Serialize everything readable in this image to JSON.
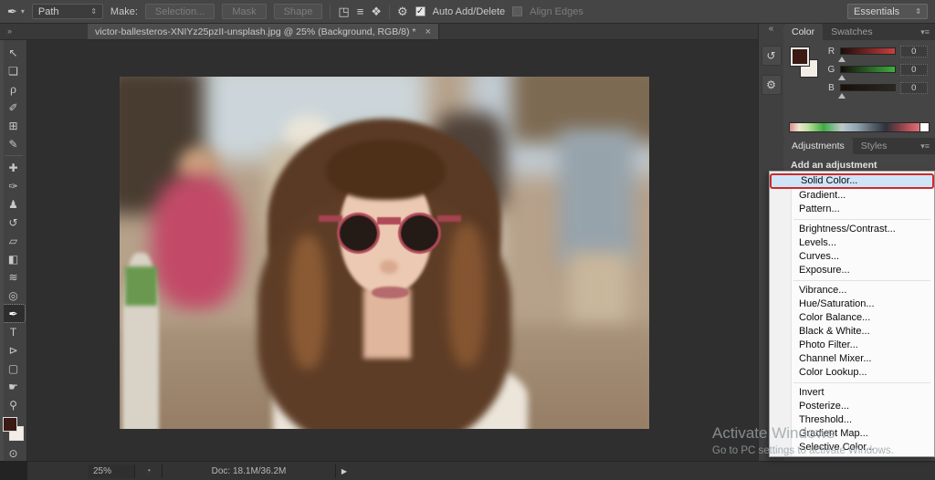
{
  "options_bar": {
    "tool_icon": "pen-icon",
    "path_mode": "Path",
    "make_label": "Make:",
    "selection_button": "Selection...",
    "mask_button": "Mask",
    "shape_button": "Shape",
    "auto_add_delete_label": "Auto Add/Delete",
    "align_edges_label": "Align Edges",
    "workspace": "Essentials"
  },
  "tab_bar": {
    "collapse_glyph": "»",
    "tab_title": "victor-ballesteros-XNIYz25pzII-unsplash.jpg @ 25% (Background, RGB/8) *",
    "close_glyph": "×"
  },
  "tools": [
    {
      "name": "move-tool",
      "glyph": "↖"
    },
    {
      "name": "rectangular-marquee-tool",
      "glyph": "❏"
    },
    {
      "name": "lasso-tool",
      "glyph": "ρ"
    },
    {
      "name": "quick-selection-tool",
      "glyph": "✐"
    },
    {
      "name": "crop-tool",
      "glyph": "⊞"
    },
    {
      "name": "eyedropper-tool",
      "glyph": "✎"
    },
    {
      "type": "sep"
    },
    {
      "name": "healing-brush-tool",
      "glyph": "✚"
    },
    {
      "name": "brush-tool",
      "glyph": "✑"
    },
    {
      "name": "clone-stamp-tool",
      "glyph": "♟"
    },
    {
      "name": "history-brush-tool",
      "glyph": "↺"
    },
    {
      "name": "eraser-tool",
      "glyph": "▱"
    },
    {
      "name": "gradient-tool",
      "glyph": "◧"
    },
    {
      "name": "blur-tool",
      "glyph": "≋"
    },
    {
      "name": "dodge-tool",
      "glyph": "◎"
    },
    {
      "name": "pen-tool",
      "glyph": "✒",
      "selected": true
    },
    {
      "name": "type-tool",
      "glyph": "T"
    },
    {
      "name": "path-selection-tool",
      "glyph": "⊳"
    },
    {
      "name": "shape-tool",
      "glyph": "▢"
    },
    {
      "name": "hand-tool",
      "glyph": "☛"
    },
    {
      "name": "zoom-tool",
      "glyph": "⚲"
    }
  ],
  "tool_colors": {
    "foreground": "#3a1a12",
    "background": "#f2eee6"
  },
  "dock_strip": {
    "collapse_glyph": "«",
    "icons": [
      {
        "name": "history-panel-icon",
        "glyph": "↺"
      },
      {
        "name": "properties-panel-icon",
        "glyph": "⚙"
      }
    ]
  },
  "color_panel": {
    "tab_color": "Color",
    "tab_swatches": "Swatches",
    "menu_glyph": "▾≡",
    "channels": [
      {
        "label": "R",
        "value": "0",
        "key": "r"
      },
      {
        "label": "G",
        "value": "0",
        "key": "g"
      },
      {
        "label": "B",
        "value": "0",
        "key": "b"
      }
    ]
  },
  "adjustments_panel": {
    "tab_adjustments": "Adjustments",
    "tab_styles": "Styles",
    "menu_glyph": "▾≡",
    "heading": "Add an adjustment",
    "icon_rows": [
      [
        {
          "name": "brightness-contrast-icon",
          "glyph": "☼"
        },
        {
          "name": "levels-icon",
          "glyph": "▟"
        },
        {
          "name": "curves-icon",
          "glyph": "⊿"
        },
        {
          "name": "exposure-icon",
          "glyph": "±"
        },
        {
          "name": "vibrance-icon",
          "glyph": "▽"
        }
      ],
      [
        {
          "name": "hue-saturation-icon",
          "glyph": "▤"
        },
        {
          "name": "color-balance-icon",
          "glyph": "◫"
        },
        {
          "name": "black-white-icon",
          "glyph": "◧"
        },
        {
          "name": "photo-filter-icon",
          "glyph": "◒"
        },
        {
          "name": "channel-mixer-icon",
          "glyph": "☻"
        },
        {
          "name": "color-lookup-icon",
          "glyph": "▦"
        }
      ]
    ]
  },
  "adjustment_menu": {
    "highlighted": "Solid Color...",
    "highlight_border_color": "#cc2a2a",
    "highlight_fill_color": "#cfe4f7",
    "groups": [
      [
        "Solid Color...",
        "Gradient...",
        "Pattern..."
      ],
      [
        "Brightness/Contrast...",
        "Levels...",
        "Curves...",
        "Exposure..."
      ],
      [
        "Vibrance...",
        "Hue/Saturation...",
        "Color Balance...",
        "Black & White...",
        "Photo Filter...",
        "Channel Mixer...",
        "Color Lookup..."
      ],
      [
        "Invert",
        "Posterize...",
        "Threshold...",
        "Gradient Map...",
        "Selective Color..."
      ]
    ]
  },
  "status_bar": {
    "zoom": "25%",
    "clock_glyph": "◔",
    "doc_info": "Doc: 18.1M/36.2M",
    "flyout_glyph": "▶"
  },
  "watermark": {
    "line1": "Activate Windows",
    "line2": "Go to PC settings to activate Windows."
  }
}
